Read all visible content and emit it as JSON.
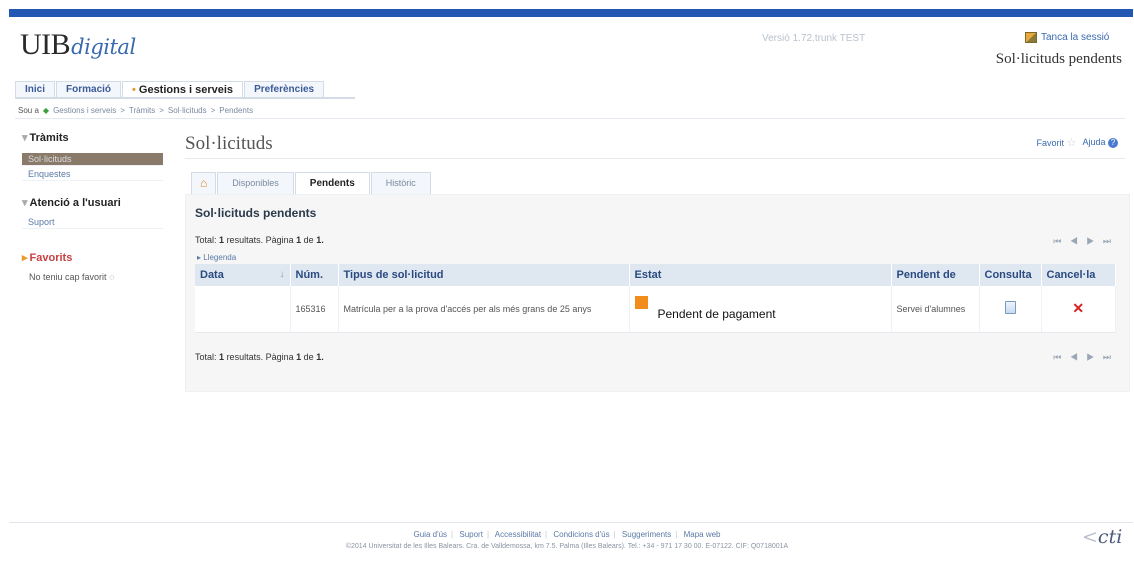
{
  "header": {
    "logo_main": "UIB",
    "logo_suffix": "digital",
    "version": "Versió 1.72.trunk TEST",
    "logout_label": "Tanca la sessió",
    "page_heading": "Sol·licituds pendents",
    "accent_color": "#2258b4"
  },
  "nav": {
    "tabs": [
      {
        "label": "Inici"
      },
      {
        "label": "Formació"
      },
      {
        "label": "Gestions i serveis"
      },
      {
        "label": "Preferències"
      }
    ]
  },
  "breadcrumb": {
    "prefix": "Sou a",
    "items": [
      "Gestions i serveis",
      "Tràmits",
      "Sol·licituds",
      "Pendents"
    ]
  },
  "sidebar": {
    "sections": [
      {
        "title": "Tràmits",
        "items": [
          "Sol·licituds",
          "Enquestes"
        ]
      },
      {
        "title": "Atenció a l'usuari",
        "items": [
          "Suport"
        ]
      }
    ],
    "favorites_title": "Favorits",
    "favorites_empty": "No teniu cap favorit"
  },
  "main": {
    "title": "Sol·licituds",
    "favorit_label": "Favorit",
    "ajuda_label": "Ajuda",
    "subtabs": [
      "Disponibles",
      "Pendents",
      "Històric"
    ],
    "panel_title": "Sol·licituds pendents",
    "summary": {
      "pre": "Total:",
      "count": "1",
      "mid": "resultats. Pàgina",
      "page": "1",
      "de": "de",
      "pages": "1."
    },
    "legend_label": "Llegenda",
    "pager_glyphs": "⏮ ◀ ▶ ⏭"
  },
  "table": {
    "headers": [
      "Data",
      "Núm.",
      "Tipus de sol·licitud",
      "Estat",
      "Pendent de",
      "Consulta",
      "Cancel·la"
    ],
    "rows": [
      {
        "data": "",
        "num": "165316",
        "tipus": "Matrícula per a la prova d'accés per als més grans de 25 anys",
        "estat": "Pendent de pagament",
        "estat_color": "#f28c1a",
        "pendent_de": "Servei d'alumnes"
      }
    ]
  },
  "footer": {
    "links": [
      "Guia d'ús",
      "Suport",
      "Accessibilitat",
      "Condicions d'ús",
      "Suggeriments",
      "Mapa web"
    ],
    "copyright": "©2014 Universitat de les Illes Balears. Cra. de Valldemossa, km 7.5. Palma (Illes Balears). Tel.: +34 - 971 17 30 00. E-07122. CIF: Q0718001A",
    "brand_c": "<",
    "brand_text": "cti"
  }
}
